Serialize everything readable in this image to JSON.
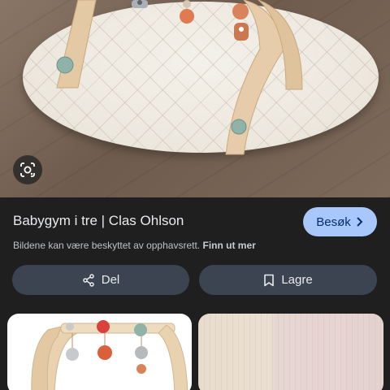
{
  "result": {
    "title": "Babygym i tre | Clas Ohlson",
    "visit_label": "Besøk",
    "copyright_text": "Bildene kan være beskyttet av opphavsrett.",
    "learn_more_label": "Finn ut mer"
  },
  "actions": {
    "share_label": "Del",
    "save_label": "Lagre"
  },
  "icons": {
    "lens": "google-lens-icon",
    "visit": "chevron-right-icon",
    "share": "share-icon",
    "save": "bookmark-icon"
  },
  "colors": {
    "background": "#1f1f1f",
    "visit_button": "#a8c7fa",
    "action_button": "#3c4452"
  }
}
